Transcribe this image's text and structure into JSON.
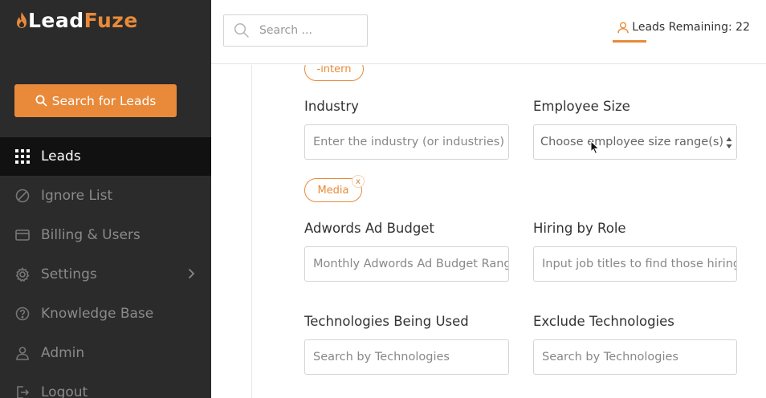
{
  "app": {
    "logo_lead": "Lead",
    "logo_fuze": "Fuze",
    "brand_color": "#e88a3a"
  },
  "sidebar": {
    "search_button": "Search for Leads",
    "items": [
      {
        "label": "Leads",
        "icon": "grid-icon",
        "active": true
      },
      {
        "label": "Ignore List",
        "icon": "block-icon"
      },
      {
        "label": "Billing & Users",
        "icon": "credit-card-icon"
      },
      {
        "label": "Settings",
        "icon": "gear-icon"
      },
      {
        "label": "Knowledge Base",
        "icon": "question-circle-icon"
      },
      {
        "label": "Admin",
        "icon": "user-icon"
      },
      {
        "label": "Logout",
        "icon": "logout-icon"
      }
    ]
  },
  "topbar": {
    "search_placeholder": "Search ...",
    "leads_remaining": "Leads Remaining: 22"
  },
  "form": {
    "intern_tag": "-intern",
    "industry_label": "Industry",
    "industry_placeholder": "Enter the industry (or industries) fo",
    "employee_size_label": "Employee Size",
    "employee_size_placeholder": "Choose employee size range(s)",
    "media_tag": "Media",
    "tag_remove": "x",
    "adwords_label": "Adwords Ad Budget",
    "adwords_placeholder": "Monthly Adwords Ad Budget Rang",
    "hiring_label": "Hiring by Role",
    "hiring_placeholder": "Input job titles to find those hiring",
    "tech_used_label": "Technologies Being Used",
    "tech_used_placeholder": "Search by Technologies",
    "exclude_tech_label": "Exclude Technologies",
    "exclude_tech_placeholder": "Search by Technologies"
  }
}
